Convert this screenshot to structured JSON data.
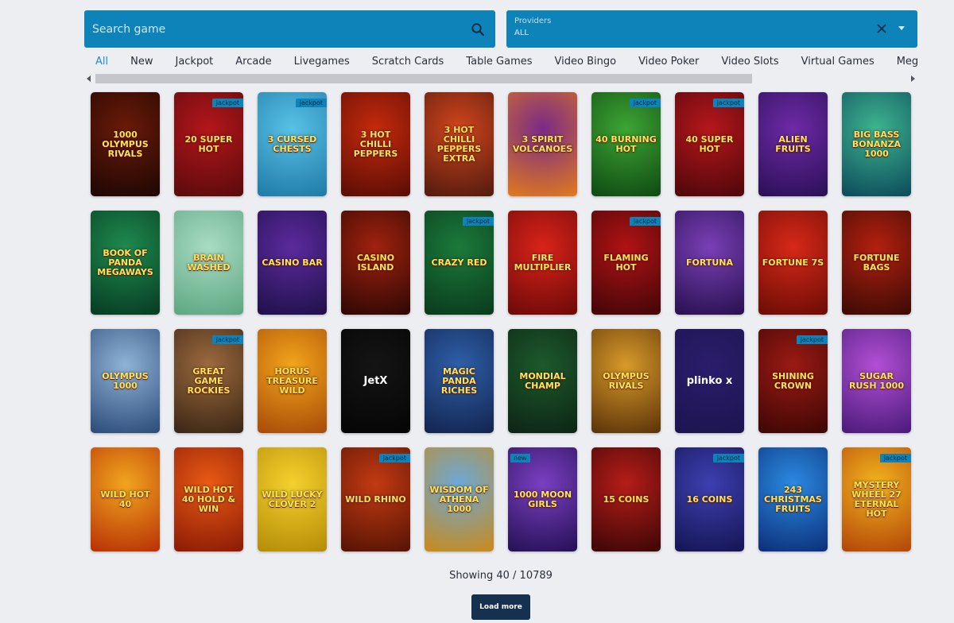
{
  "search": {
    "placeholder": "Search game",
    "value": ""
  },
  "providers": {
    "label": "Providers",
    "value": "ALL"
  },
  "tabs": [
    {
      "label": "All",
      "active": true
    },
    {
      "label": "New"
    },
    {
      "label": "Jackpot"
    },
    {
      "label": "Arcade"
    },
    {
      "label": "Livegames"
    },
    {
      "label": "Scratch Cards"
    },
    {
      "label": "Table Games"
    },
    {
      "label": "Video Bingo"
    },
    {
      "label": "Video Poker"
    },
    {
      "label": "Video Slots"
    },
    {
      "label": "Virtual Games"
    },
    {
      "label": "Megaways"
    }
  ],
  "games": [
    {
      "title": "1000 Olympus Rivals",
      "bg": [
        "#6b1a08",
        "#1d0603"
      ]
    },
    {
      "title": "20 Super Hot",
      "badge": "jackpot",
      "bg": [
        "#b3161a",
        "#5a0a0c"
      ]
    },
    {
      "title": "3 Cursed Chests",
      "badge": "jackpot",
      "bg": [
        "#58c1e6",
        "#1f7aa7"
      ]
    },
    {
      "title": "3 Hot Chilli Peppers",
      "bg": [
        "#c42a0c",
        "#5b0c04"
      ]
    },
    {
      "title": "3 Hot Chilli Peppers Extra",
      "bg": [
        "#d0451d",
        "#521a0d"
      ]
    },
    {
      "title": "3 Spirit Volcanoes",
      "bg": [
        "#7a2a88",
        "#e07a1c"
      ]
    },
    {
      "title": "40 Burning Hot",
      "badge": "jackpot",
      "bg": [
        "#3ea434",
        "#0e4a12"
      ]
    },
    {
      "title": "40 Super Hot",
      "badge": "jackpot",
      "bg": [
        "#b5171c",
        "#4e0609"
      ]
    },
    {
      "title": "Alien Fruits",
      "bg": [
        "#6d2aa6",
        "#2b0f57"
      ]
    },
    {
      "title": "Big Bass Bonanza 1000",
      "bg": [
        "#3eb48f",
        "#0b4a5a"
      ]
    },
    {
      "title": "Book of Panda Megaways",
      "bg": [
        "#1f8a4e",
        "#063b22"
      ]
    },
    {
      "title": "Brain Washed",
      "bg": [
        "#a8dcc1",
        "#5da682"
      ]
    },
    {
      "title": "Casino Bar",
      "bg": [
        "#5b2a9e",
        "#20104a"
      ]
    },
    {
      "title": "Casino Island",
      "bg": [
        "#a0220f",
        "#2e0703"
      ]
    },
    {
      "title": "Crazy Red",
      "badge": "jackpot",
      "bg": [
        "#1b7a3a",
        "#093a1c"
      ]
    },
    {
      "title": "Fire Multiplier",
      "bg": [
        "#d8231a",
        "#6d0906"
      ]
    },
    {
      "title": "Flaming Hot",
      "badge": "jackpot",
      "bg": [
        "#b01315",
        "#420507"
      ]
    },
    {
      "title": "Fortuna",
      "bg": [
        "#7a3fb6",
        "#27104f"
      ]
    },
    {
      "title": "Fortune 7s",
      "bg": [
        "#d72818",
        "#6b0c05"
      ]
    },
    {
      "title": "Fortune Bags",
      "bg": [
        "#b32010",
        "#3a0a04"
      ]
    },
    {
      "title": "Olympus 1000",
      "bg": [
        "#8fb3d6",
        "#2b4a78"
      ]
    },
    {
      "title": "Great Game Rockies",
      "badge": "jackpot",
      "bg": [
        "#9c6a3e",
        "#3a2514"
      ]
    },
    {
      "title": "Horus Treasure Wild",
      "bg": [
        "#f2a51b",
        "#a74a08"
      ]
    },
    {
      "title": "JetX",
      "plain": true,
      "bg": [
        "#141414",
        "#050505"
      ]
    },
    {
      "title": "Magic Panda Riches",
      "bg": [
        "#2e5fa8",
        "#12244f"
      ]
    },
    {
      "title": "Mondial Champ",
      "bg": [
        "#1d5a2c",
        "#0c2414"
      ]
    },
    {
      "title": "Olympus Rivals",
      "bg": [
        "#d89a2a",
        "#5a3208"
      ]
    },
    {
      "title": "plinko x",
      "plain": true,
      "bg": [
        "#2b1d6b",
        "#1c1450"
      ]
    },
    {
      "title": "Shining Crown",
      "badge": "jackpot",
      "bg": [
        "#9b1a14",
        "#3d0604"
      ]
    },
    {
      "title": "Sugar Rush 1000",
      "bg": [
        "#b24fd4",
        "#4a1a7a"
      ]
    },
    {
      "title": "Wild Hot 40",
      "bg": [
        "#f0a51e",
        "#b83005"
      ]
    },
    {
      "title": "Wild Hot 40 Hold & Win",
      "bg": [
        "#e95a14",
        "#8a1a05"
      ]
    },
    {
      "title": "Wild Lucky Clover 2",
      "bg": [
        "#f3d12e",
        "#b58b06"
      ]
    },
    {
      "title": "Wild Rhino",
      "badge": "jackpot",
      "bg": [
        "#c23a12",
        "#561304"
      ]
    },
    {
      "title": "Wisdom of Athena 1000",
      "bg": [
        "#6ba9d8",
        "#c98a18"
      ]
    },
    {
      "title": "1000 Moon Girls",
      "badge_left": "new",
      "bg": [
        "#7b3fc2",
        "#241054"
      ]
    },
    {
      "title": "15 Coins",
      "bg": [
        "#b51d18",
        "#3c0606"
      ]
    },
    {
      "title": "16 Coins",
      "badge": "jackpot",
      "bg": [
        "#3d3fb0",
        "#141553"
      ]
    },
    {
      "title": "243 Christmas Fruits",
      "bg": [
        "#2b8ae0",
        "#0b2f7a"
      ]
    },
    {
      "title": "Mystery Wheel 27 Eternal Hot",
      "badge": "jackpot",
      "bg": [
        "#f2b41e",
        "#b24508"
      ]
    }
  ],
  "footer": {
    "showing_text": "Showing 40 / 10789",
    "load_more_label": "Load more"
  }
}
